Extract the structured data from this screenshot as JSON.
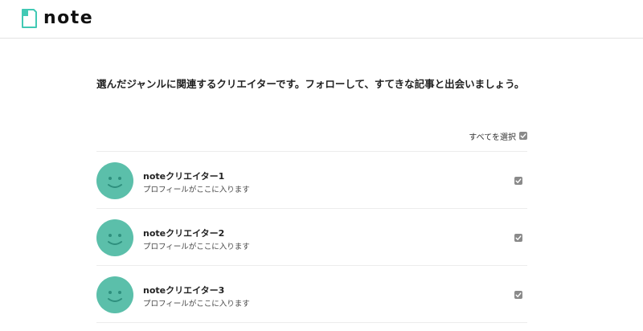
{
  "header": {
    "logo_text": "note",
    "logo_icon": "note-logo-icon",
    "brand_color": "#41c9b4"
  },
  "main": {
    "lead_text": "選んだジャンルに関連するクリエイターです。フォローして、すてきな記事と出会いましょう。",
    "select_all_label": "すべてを選択",
    "select_all_checked": true
  },
  "creators": [
    {
      "name": "noteクリエイター1",
      "profile": "プロフィールがここに入ります",
      "checked": true,
      "avatar_icon": "smiley-face-icon"
    },
    {
      "name": "noteクリエイター2",
      "profile": "プロフィールがここに入ります",
      "checked": true,
      "avatar_icon": "smiley-face-icon"
    },
    {
      "name": "noteクリエイター3",
      "profile": "プロフィールがここに入ります",
      "checked": true,
      "avatar_icon": "smiley-face-icon"
    }
  ],
  "colors": {
    "avatar": "#5bbfaa",
    "checkbox": "#8a8a8a",
    "divider": "#ececec"
  }
}
